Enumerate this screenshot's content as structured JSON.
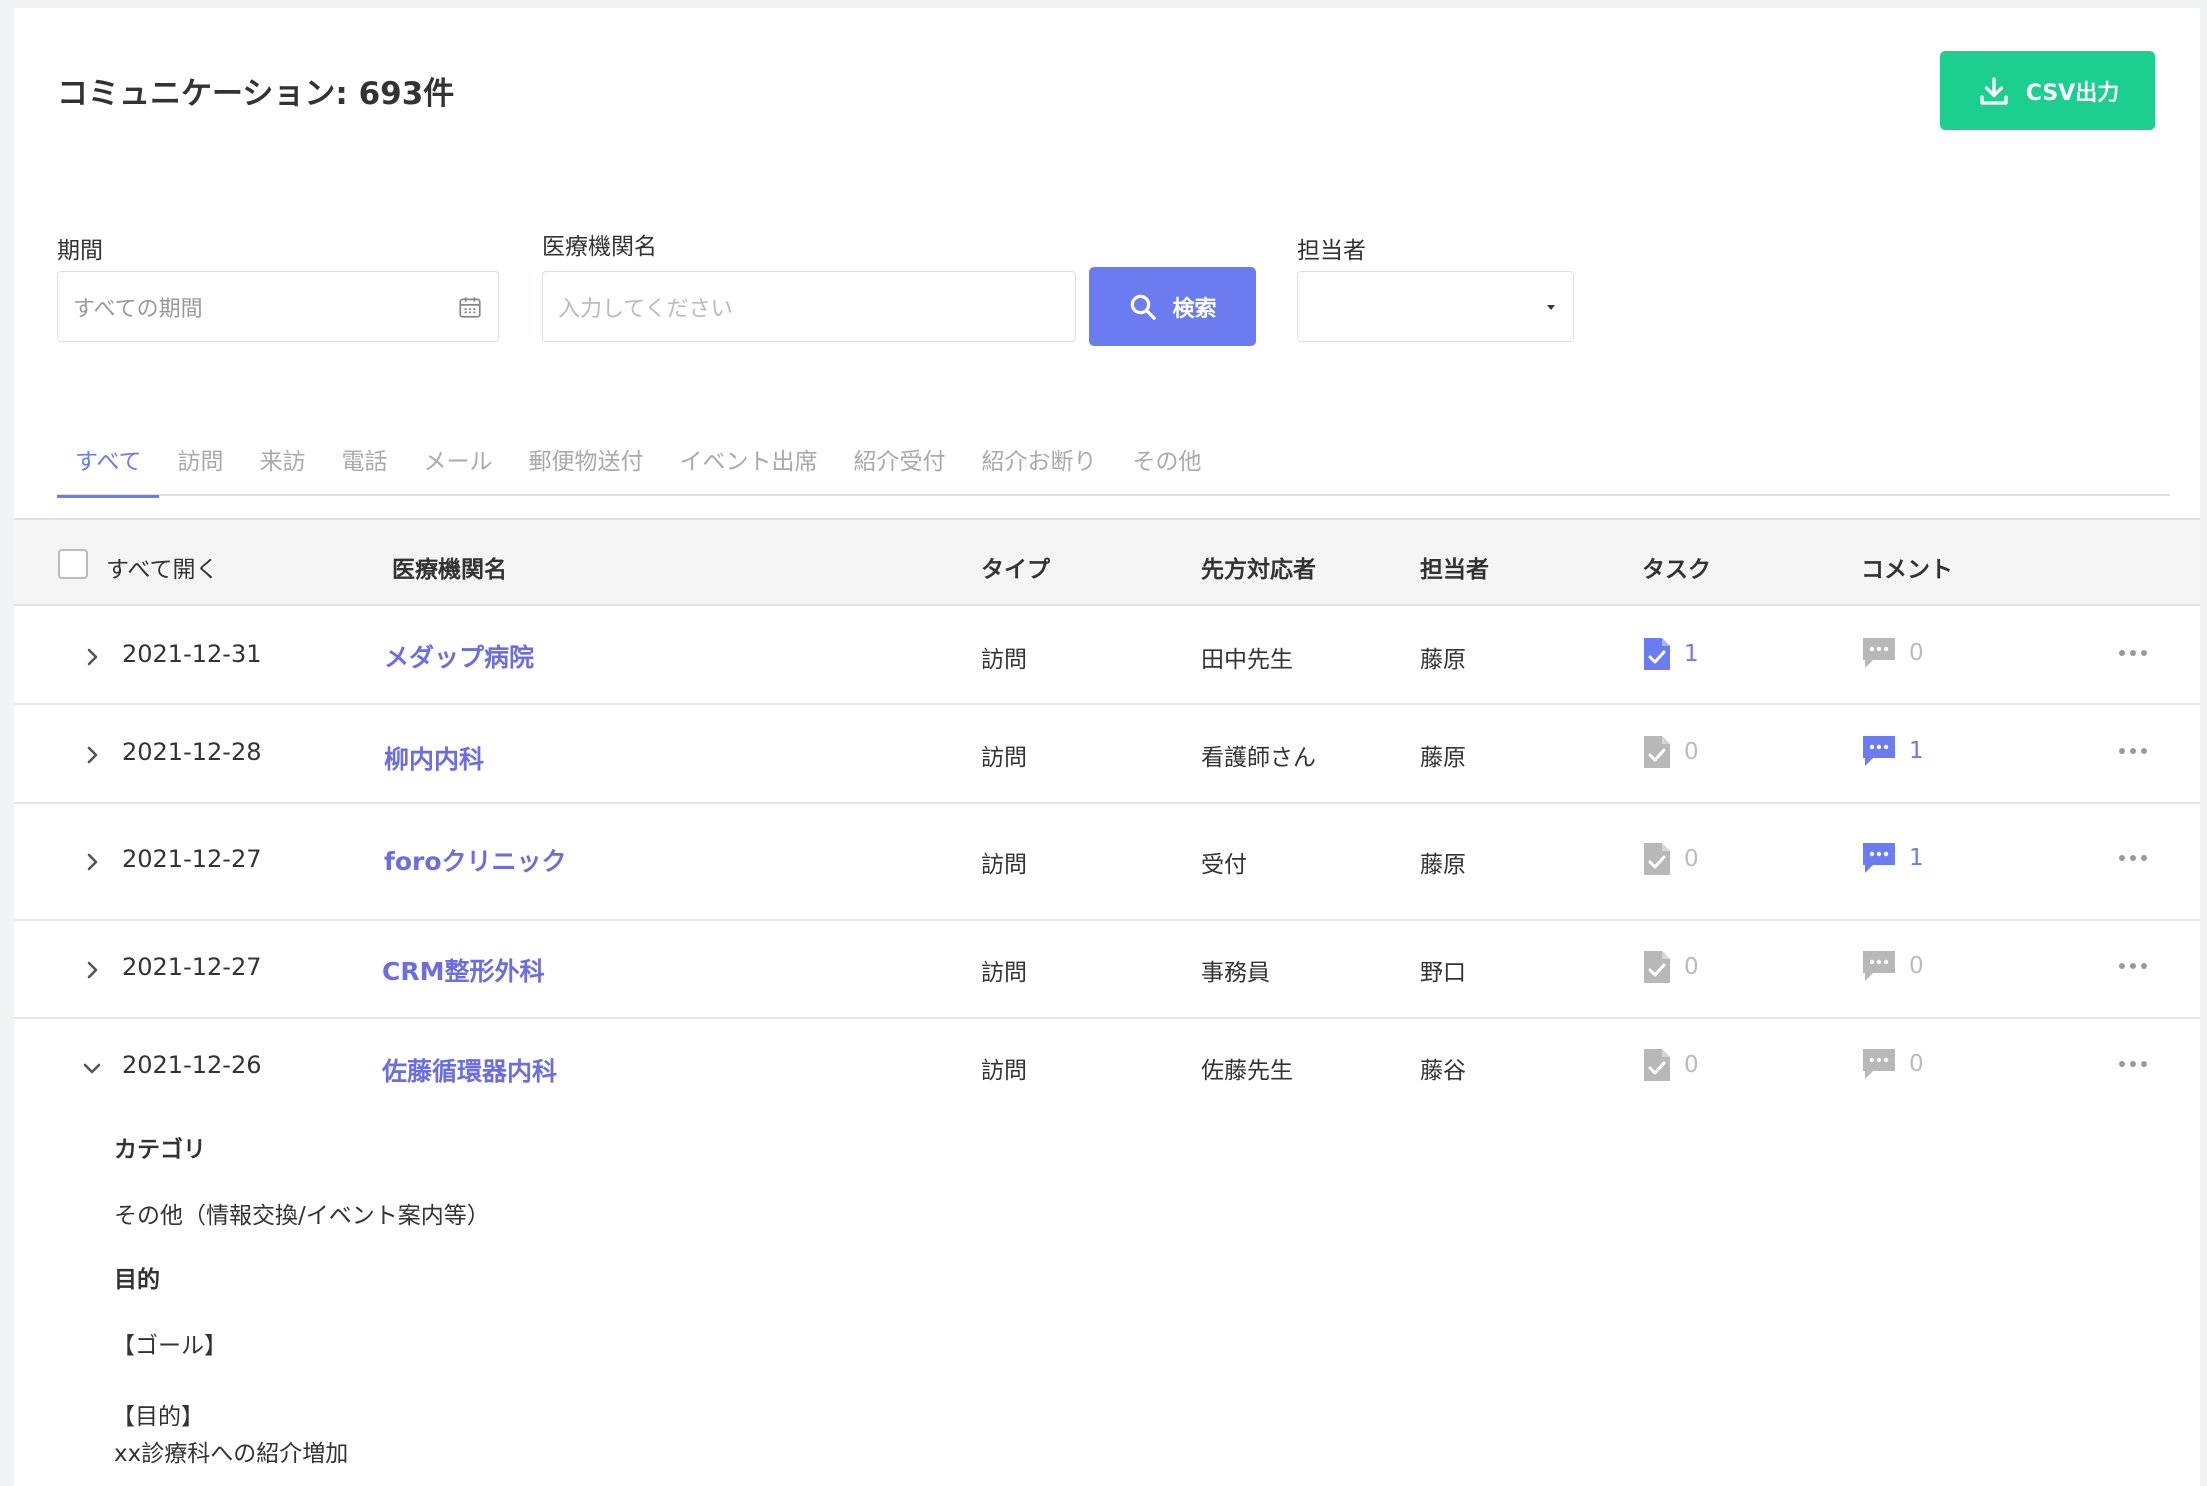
{
  "header": {
    "title": "コミュニケーション: 693件",
    "csv_label": "CSV出力"
  },
  "filters": {
    "period_label": "期間",
    "period_placeholder": "すべての期間",
    "hospital_label": "医療機関名",
    "hospital_placeholder": "入力してください",
    "search_label": "検索",
    "staff_label": "担当者",
    "staff_value": ""
  },
  "tabs": [
    "すべて",
    "訪問",
    "来訪",
    "電話",
    "メール",
    "郵便物送付",
    "イベント出席",
    "紹介受付",
    "紹介お断り",
    "その他"
  ],
  "active_tab": "すべて",
  "table": {
    "headers": {
      "open_all": "すべて開く",
      "hospital": "医療機関名",
      "type": "タイプ",
      "responder": "先方対応者",
      "staff": "担当者",
      "task": "タスク",
      "comment": "コメント"
    },
    "rows": [
      {
        "date": "2021-12-31",
        "hospital": "メダップ病院",
        "type": "訪問",
        "responder": "田中先生",
        "staff": "藤原",
        "task": "1",
        "comment": "0",
        "expanded": false
      },
      {
        "date": "2021-12-28",
        "hospital": "柳内内科",
        "type": "訪問",
        "responder": "看護師さん",
        "staff": "藤原",
        "task": "0",
        "comment": "1",
        "expanded": false
      },
      {
        "date": "2021-12-27",
        "hospital": "foroクリニック",
        "type": "訪問",
        "responder": "受付",
        "staff": "藤原",
        "task": "0",
        "comment": "1",
        "expanded": false
      },
      {
        "date": "2021-12-27",
        "hospital": "CRM整形外科",
        "type": "訪問",
        "responder": "事務員",
        "staff": "野口",
        "task": "0",
        "comment": "0",
        "expanded": false
      },
      {
        "date": "2021-12-26",
        "hospital": "佐藤循環器内科",
        "type": "訪問",
        "responder": "佐藤先生",
        "staff": "藤谷",
        "task": "0",
        "comment": "0",
        "expanded": true
      }
    ]
  },
  "detail": {
    "category_label": "カテゴリ",
    "category_value": "その他（情報交換/イベント案内等）",
    "purpose_label": "目的",
    "goal_heading": "【ゴール】",
    "purpose_heading": "【目的】",
    "purpose_text": "xx診療科への紹介増加"
  },
  "colors": {
    "accent": "#6b7bf0",
    "csv": "#1ccf8e",
    "link": "#6b6ee0",
    "inactive_icon": "#b8b8b8"
  }
}
